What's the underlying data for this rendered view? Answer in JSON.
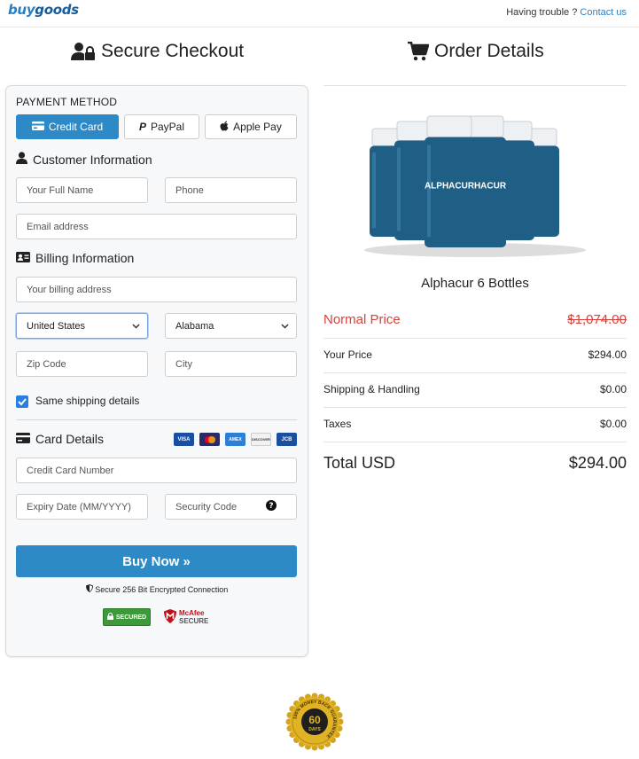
{
  "header": {
    "logo_buy": "buy",
    "logo_goods": "goods",
    "trouble_text": "Having trouble ?",
    "contact_link": "Contact us"
  },
  "checkout": {
    "title": "Secure Checkout",
    "payment_method_label": "PAYMENT METHOD",
    "payment_methods": [
      {
        "label": "Credit Card",
        "active": true
      },
      {
        "label": "PayPal",
        "active": false
      },
      {
        "label": "Apple Pay",
        "active": false
      }
    ],
    "customer_info_title": "Customer Information",
    "full_name_placeholder": "Your Full Name",
    "phone_placeholder": "Phone",
    "email_placeholder": "Email address",
    "billing_info_title": "Billing Information",
    "billing_address_placeholder": "Your billing address",
    "country_value": "United States",
    "state_value": "Alabama",
    "zip_placeholder": "Zip Code",
    "city_placeholder": "City",
    "same_shipping_label": "Same shipping details",
    "same_shipping_checked": true,
    "card_details_title": "Card Details",
    "card_brands": [
      "VISA",
      "MC",
      "AMEX",
      "DISCOVER",
      "JCB"
    ],
    "card_number_placeholder": "Credit Card Number",
    "expiry_placeholder": "Expiry Date (MM/YYYY)",
    "security_code_placeholder": "Security Code",
    "buy_button": "Buy Now »",
    "secure_text": "Secure 256 Bit Encrypted Connection",
    "badge_secured": "SECURED",
    "badge_mcafee_1": "McAfee",
    "badge_mcafee_2": "SECURE"
  },
  "order": {
    "title": "Order Details",
    "product_name": "Alphacur 6 Bottles",
    "bottle_brand": "ALPHACUR",
    "normal_price_label": "Normal Price",
    "normal_price_value": "$1,074.00",
    "your_price_label": "Your Price",
    "your_price_value": "$294.00",
    "shipping_label": "Shipping & Handling",
    "shipping_value": "$0.00",
    "taxes_label": "Taxes",
    "taxes_value": "$0.00",
    "total_label": "Total USD",
    "total_value": "$294.00"
  },
  "guarantee": {
    "days": "60",
    "days_label": "DAYS",
    "ring_text": "100% MONEY BACK GUARANTEE"
  },
  "colors": {
    "primary": "#2d8ac6",
    "normal_price": "#d9403a",
    "checkbox": "#2a7de1",
    "gold": "#e0b326"
  }
}
